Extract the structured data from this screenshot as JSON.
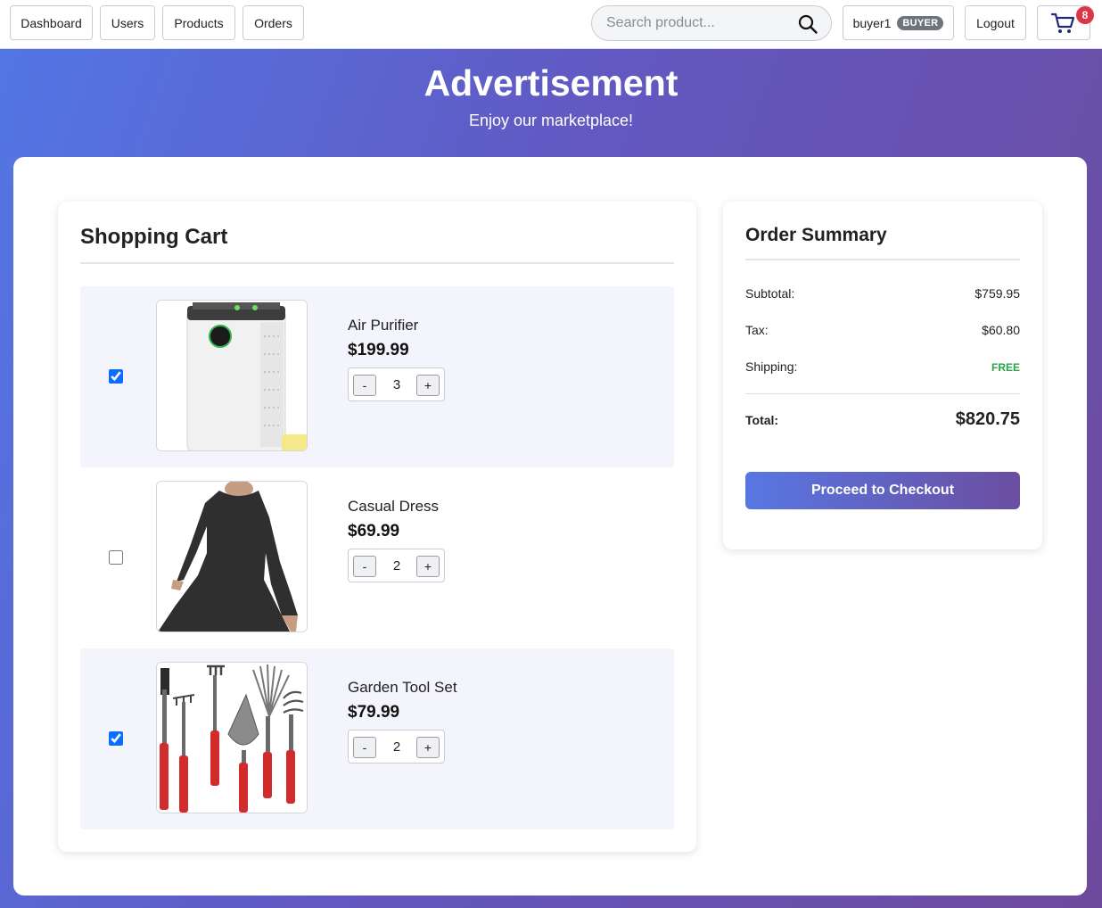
{
  "nav": {
    "dashboard_label": "Dashboard",
    "users_label": "Users",
    "products_label": "Products",
    "orders_label": "Orders",
    "search_placeholder": "Search product...",
    "username": "buyer1",
    "role_badge": "BUYER",
    "logout_label": "Logout",
    "cart_count": "8"
  },
  "hero": {
    "title": "Advertisement",
    "subtitle": "Enjoy our marketplace!"
  },
  "cart": {
    "title": "Shopping Cart",
    "items": [
      {
        "name": "Air Purifier",
        "price": "$199.99",
        "qty": "3",
        "selected": true,
        "minus": "-",
        "plus": "+"
      },
      {
        "name": "Casual Dress",
        "price": "$69.99",
        "qty": "2",
        "selected": false,
        "minus": "-",
        "plus": "+"
      },
      {
        "name": "Garden Tool Set",
        "price": "$79.99",
        "qty": "2",
        "selected": true,
        "minus": "-",
        "plus": "+"
      }
    ]
  },
  "summary": {
    "title": "Order Summary",
    "subtotal_label": "Subtotal:",
    "subtotal_value": "$759.95",
    "tax_label": "Tax:",
    "tax_value": "$60.80",
    "shipping_label": "Shipping:",
    "shipping_value": "FREE",
    "total_label": "Total:",
    "total_value": "$820.75",
    "checkout_label": "Proceed to Checkout"
  },
  "colors": {
    "accent_gradient_start": "#5277e6",
    "accent_gradient_end": "#6e4a9c",
    "free_shipping": "#28a745",
    "cart_badge": "#dc3545",
    "checkbox": "#0b6efd"
  },
  "icons": {
    "search": "search-icon",
    "cart": "shopping-cart-icon"
  }
}
